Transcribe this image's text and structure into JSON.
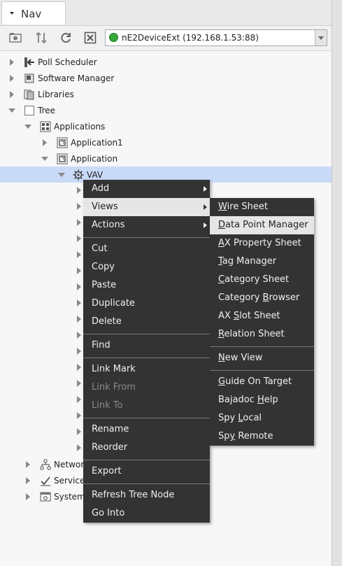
{
  "nav": {
    "title": "Nav"
  },
  "toolbar": {
    "station": "nE2DeviceExt (192.168.1.53:88)",
    "status_color": "#35a83a"
  },
  "tree": {
    "poll_scheduler": "Poll Scheduler",
    "software_manager": "Software Manager",
    "libraries": "Libraries",
    "tree": "Tree",
    "applications": "Applications",
    "application1": "Application1",
    "application": "Application",
    "vav": "VAV",
    "network": "Network",
    "services": "Services",
    "system": "System"
  },
  "context_menu": {
    "add": "Add",
    "views": "Views",
    "actions": "Actions",
    "cut": "Cut",
    "copy": "Copy",
    "paste": "Paste",
    "duplicate": "Duplicate",
    "delete": "Delete",
    "find": "Find",
    "link_mark": "Link Mark",
    "link_from": "Link From",
    "link_to": "Link To",
    "rename": "Rename",
    "reorder": "Reorder",
    "export": "Export",
    "refresh_tree_node": "Refresh Tree Node",
    "go_into": "Go Into"
  },
  "views_menu": {
    "wire_sheet": {
      "u": "W",
      "rest": "ire Sheet"
    },
    "data_point_manager": {
      "pre": "",
      "u": "D",
      "rest": "ata Point Manager"
    },
    "ax_property_sheet": {
      "pre": "",
      "u": "A",
      "rest": "X Property Sheet"
    },
    "tag_manager": {
      "pre": "",
      "u": "T",
      "rest": "ag Manager"
    },
    "category_sheet": {
      "pre": "",
      "u": "C",
      "rest": "ategory Sheet"
    },
    "category_browser": {
      "pre": "Category ",
      "u": "B",
      "rest": "rowser"
    },
    "ax_slot_sheet": {
      "pre": "AX ",
      "u": "S",
      "rest": "lot Sheet"
    },
    "relation_sheet": {
      "pre": "",
      "u": "R",
      "rest": "elation Sheet"
    },
    "new_view": {
      "pre": "",
      "u": "N",
      "rest": "ew View"
    },
    "guide_on_target": {
      "pre": "",
      "u": "G",
      "rest": "uide On Target"
    },
    "bajadoc_help": {
      "pre": "Bajadoc ",
      "u": "H",
      "rest": "elp"
    },
    "spy_local": {
      "pre": "Spy ",
      "u": "L",
      "rest": "ocal"
    },
    "spy_remote": {
      "pre": "Sp",
      "u": "y",
      "rest": " Remote"
    }
  }
}
